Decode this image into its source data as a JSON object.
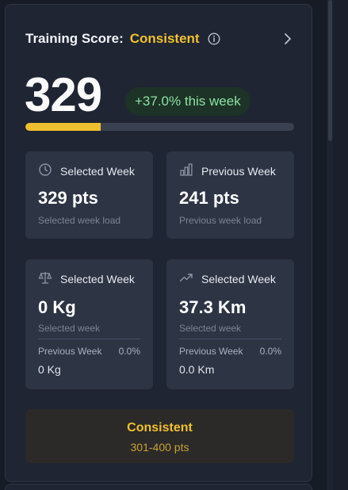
{
  "header": {
    "title": "Training Score:",
    "status": "Consistent",
    "info_icon": "info-icon",
    "chevron_icon": "chevron-right-icon"
  },
  "score": {
    "value": "329",
    "change": "+37.0% this week",
    "progress_percent": 28
  },
  "tiles": {
    "selected_load": {
      "icon": "clock-icon",
      "title": "Selected Week",
      "value": "329 pts",
      "sub": "Selected week load"
    },
    "previous_load": {
      "icon": "bar-chart-icon",
      "title": "Previous Week",
      "value": "241 pts",
      "sub": "Previous week load"
    },
    "weight": {
      "icon": "scale-icon",
      "title": "Selected Week",
      "value": "0 Kg",
      "sub": "Selected week",
      "prev_label": "Previous Week",
      "prev_change": "0.0%",
      "prev_value": "0 Kg"
    },
    "distance": {
      "icon": "trend-up-icon",
      "title": "Selected Week",
      "value": "37.3 Km",
      "sub": "Selected week",
      "prev_label": "Previous Week",
      "prev_change": "0.0%",
      "prev_value": "0.0 Km"
    }
  },
  "status_box": {
    "title": "Consistent",
    "range": "301-400 pts"
  },
  "colors": {
    "accent": "#f2c12e",
    "positive": "#8be0a3",
    "card_bg": "#1f2533",
    "tile_bg": "#2d3444"
  }
}
